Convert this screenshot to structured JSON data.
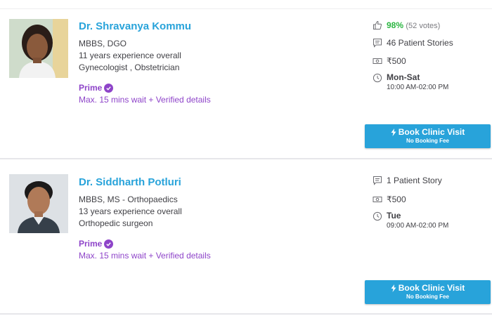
{
  "doctors": [
    {
      "name": "Dr. Shravanya Kommu",
      "qualification": "MBBS, DGO",
      "experience": "11 years experience overall",
      "specialty": "Gynecologist , Obstetrician",
      "prime_label": "Prime",
      "wait_text": "Max. 15 mins wait + Verified details",
      "rating_pct": "98%",
      "rating_votes": "(52 votes)",
      "stories": "46 Patient Stories",
      "fee": "₹500",
      "days": "Mon-Sat",
      "hours": "10:00 AM-02:00 PM",
      "book_label": "Book Clinic Visit",
      "book_sub": "No Booking Fee"
    },
    {
      "name": "Dr. Siddharth Potluri",
      "qualification": "MBBS, MS - Orthopaedics",
      "experience": "13 years experience overall",
      "specialty": "Orthopedic surgeon",
      "prime_label": "Prime",
      "wait_text": "Max. 15 mins wait + Verified details",
      "stories": "1 Patient Story",
      "fee": "₹500",
      "days": "Tue",
      "hours": "09:00 AM-02:00 PM",
      "book_label": "Book Clinic Visit",
      "book_sub": "No Booking Fee"
    }
  ],
  "icons": {
    "thumbs_up": "thumbs-up-icon",
    "stories": "chat-icon",
    "fee": "money-icon",
    "timing": "clock-icon",
    "prime": "verified-check-icon",
    "book": "lightning-icon"
  },
  "colors": {
    "link_blue": "#28a3da",
    "prime_purple": "#8e44c9",
    "rating_green": "#2ab540",
    "text_dark": "#414146"
  }
}
